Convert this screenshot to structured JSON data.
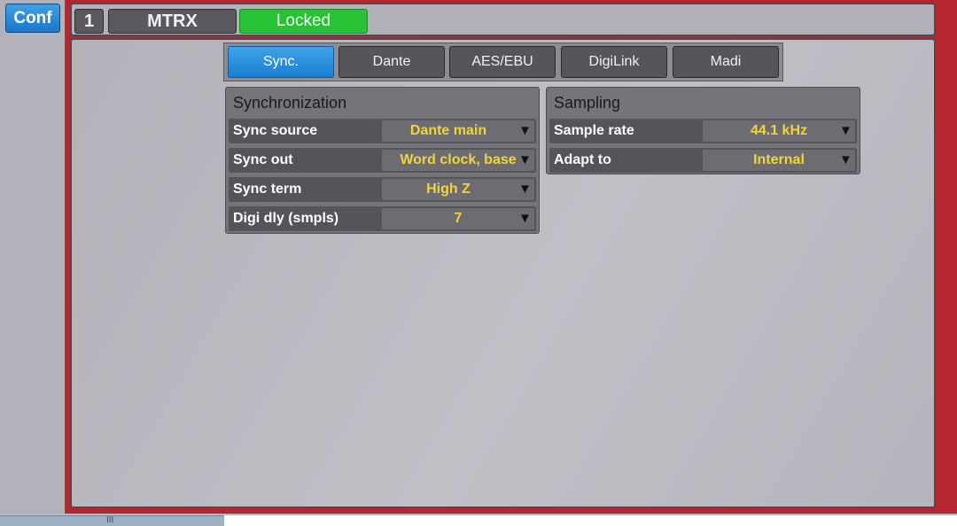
{
  "sidebar": {
    "conf_label": "Conf"
  },
  "header": {
    "number": "1",
    "name": "MTRX",
    "status": "Locked"
  },
  "tabs": [
    {
      "label": "Sync.",
      "active": true
    },
    {
      "label": "Dante",
      "active": false
    },
    {
      "label": "AES/EBU",
      "active": false
    },
    {
      "label": "DigiLink",
      "active": false
    },
    {
      "label": "Madi",
      "active": false
    }
  ],
  "synchronization": {
    "title": "Synchronization",
    "rows": [
      {
        "label": "Sync source",
        "value": "Dante main"
      },
      {
        "label": "Sync out",
        "value": "Word clock, base"
      },
      {
        "label": "Sync term",
        "value": "High Z"
      },
      {
        "label": "Digi dly (smpls)",
        "value": "7"
      }
    ]
  },
  "sampling": {
    "title": "Sampling",
    "rows": [
      {
        "label": "Sample rate",
        "value": "44.1 kHz"
      },
      {
        "label": "Adapt to",
        "value": "Internal"
      }
    ]
  },
  "dropdown_icon": "triangle-down-icon",
  "bottom_mark": "III",
  "colors": {
    "accent_blue": "#1a7fd0",
    "locked_green": "#27c236",
    "frame_red": "#b5262e",
    "value_yellow": "#f2d43a"
  }
}
